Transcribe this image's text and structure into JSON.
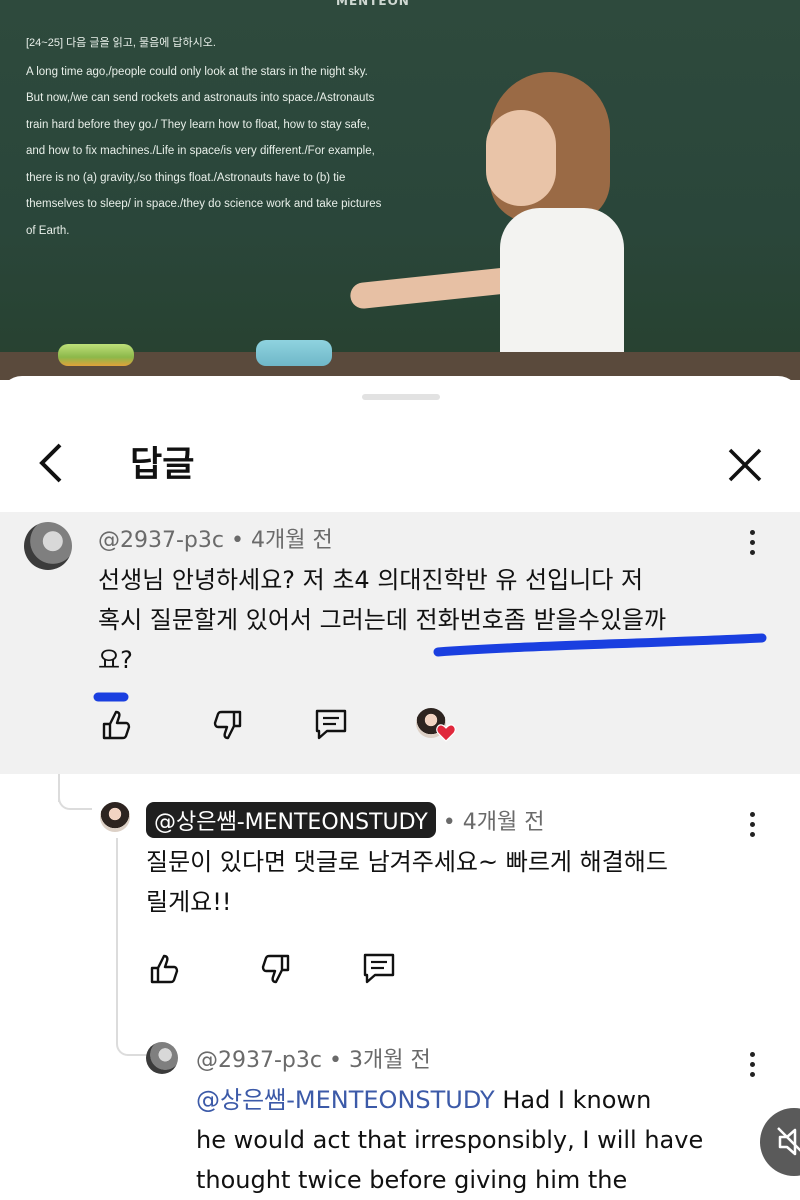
{
  "video": {
    "logo": "MENTEON",
    "board_header": "[24~25] 다음 글을 읽고, 물음에 답하시오.",
    "board_lines": [
      "A long time ago,/people could only look at the stars in the night sky.",
      "But now,/we can send rockets and astronauts into space./Astronauts",
      "train hard before they go./ They learn how to float, how to stay safe,",
      "and how to fix machines./Life in space/is very different./For example,",
      "there is no (a) gravity,/so things float./Astronauts have to (b) tie",
      "themselves to sleep/ in space./they do science work and take pictures",
      "of Earth."
    ]
  },
  "sheet": {
    "title": "답글"
  },
  "comments": [
    {
      "author": "@2937-p3c",
      "time": "4개월 전",
      "lines": [
        "선생님 안녕하세요? 저 초4 의대진학반 유   선입니다 저",
        "혹시 질문할게 있어서 그러는데 전화번호좀 받을수있을까",
        "요?"
      ]
    },
    {
      "author": "@상은쌤-MENTEONSTUDY",
      "time": "4개월 전",
      "lines": [
        "질문이 있다면 댓글로 남겨주세요~ 빠르게 해결해드",
        "릴게요!!"
      ]
    },
    {
      "author": "@2937-p3c",
      "time": "3개월 전",
      "mention": "@상은쌤-MENTEONSTUDY",
      "line1_rest": " Had I known",
      "lines": [
        "he would act that irresponsibly, I will have",
        "thought twice before giving him the"
      ]
    }
  ],
  "colors": {
    "highlight": "#1a3fe0",
    "board": "#2e4a3d",
    "mention": "#3c5aa8"
  }
}
